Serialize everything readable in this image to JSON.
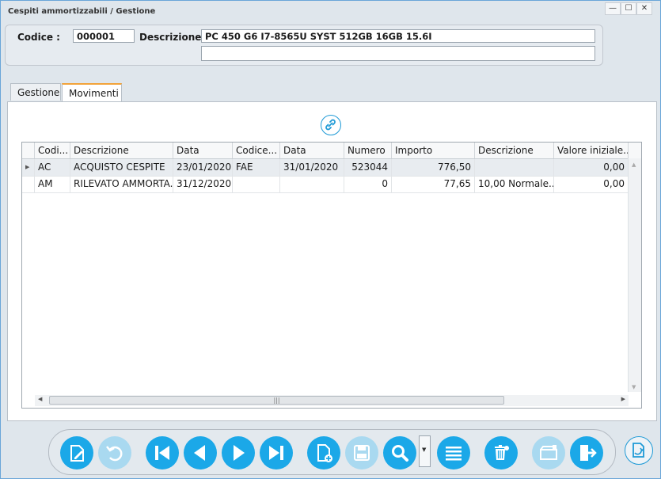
{
  "window": {
    "title": "Cespiti ammortizzabili / Gestione",
    "minimize": "—",
    "maximize": "☐",
    "close": "✕"
  },
  "header": {
    "codice_label": "Codice :",
    "codice_value": "000001",
    "descrizione_label": "Descrizione :",
    "descrizione_value": "PC 450 G6 I7-8565U SYST 512GB 16GB 15.6I",
    "descrizione2_value": ""
  },
  "tabs": [
    {
      "label": "Gestione",
      "active": false
    },
    {
      "label": "Movimenti",
      "active": true
    }
  ],
  "grid": {
    "columns": [
      "Codi...",
      "Descrizione",
      "Data",
      "Codice...",
      "Data",
      "Numero",
      "Importo",
      "Descrizione",
      "Valore iniziale..."
    ],
    "rows": [
      [
        "AC",
        "ACQUISTO CESPITE",
        "23/01/2020",
        "FAE",
        "31/01/2020",
        "523044",
        "776,50",
        "",
        "0,00"
      ],
      [
        "AM",
        "RILEVATO AMMORTA...",
        "31/12/2020",
        "",
        "",
        "0",
        "77,65",
        "10,00 Normale...",
        "0,00"
      ]
    ],
    "scroll_grip": "|||"
  },
  "toolbar": {
    "icons": [
      "edit-document-icon",
      "undo-icon",
      "first-record-icon",
      "previous-record-icon",
      "next-record-icon",
      "last-record-icon",
      "new-document-icon",
      "save-icon",
      "search-icon",
      "list-icon",
      "delete-icon",
      "archive-icon",
      "exit-icon"
    ]
  },
  "colors": {
    "accent": "#1ba8e8",
    "accent_disabled": "#a9d9f0",
    "tab_highlight": "#f2a33a"
  }
}
